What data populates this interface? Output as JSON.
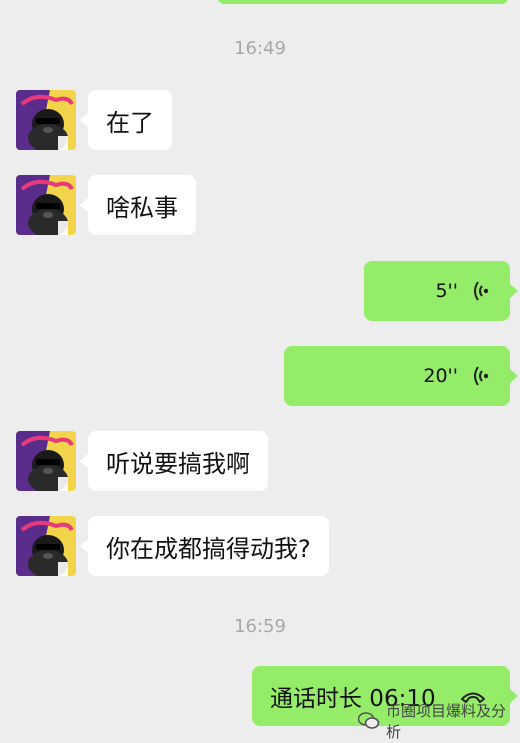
{
  "timestamps": [
    "16:49",
    "16:59"
  ],
  "messages": {
    "m1": "在了",
    "m2": "啥私事",
    "v1": "5''",
    "v2": "20''",
    "m3": "听说要搞我啊",
    "m4": "你在成都搞得动我?",
    "call_label": "通话时长 06:10"
  },
  "watermark": "币圈项目爆料及分析",
  "colors": {
    "background": "#ededed",
    "incoming_bubble": "#ffffff",
    "outgoing_bubble": "#95ec69",
    "timestamp": "#a8a8a8"
  },
  "icons": {
    "voice": "voice-wave-icon",
    "call": "phone-hangup-icon",
    "watermark": "wechat-logo-icon"
  }
}
